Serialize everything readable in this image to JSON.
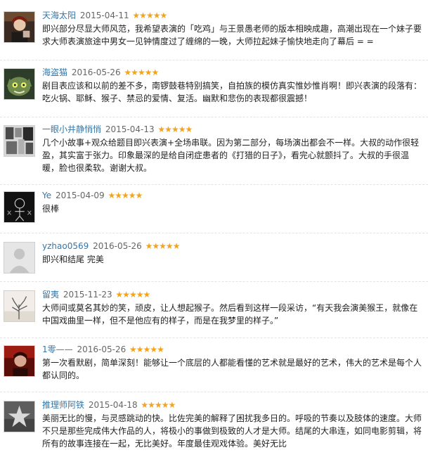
{
  "reviews": [
    {
      "user": "天海太阳",
      "date": "2015-04-11",
      "stars": "★★★★★",
      "text": "即兴部分尽显大师风范，我希望表演的「吃鸡」与王景愚老师的版本相映成趣，高潮出现在一个妹子要求大师表演旅途中男女一见钟情度过了缠绵的一晚，大师拉起妹子愉快地走向了幕后 = =",
      "avatar_icon": "portrait-avatar-icon"
    },
    {
      "user": "海盗猫",
      "date": "2016-05-26",
      "stars": "★★★★★",
      "text": "剧目表应该和以前的差不多，南锣鼓巷特别搞笑，自拍族的模仿真实惟妙惟肖啊！即兴表演的段落有：吃火锅、耶稣、猴子、禁忌的爱情、复活。幽默和悲伤的表现都很震撼！",
      "avatar_icon": "cat-avatar-icon"
    },
    {
      "user": "一眼小井静悄悄",
      "date": "2015-04-13",
      "stars": "★★★★★",
      "text": "几个小故事+观众给题目即兴表演+全场串联。因为第二部分，每场演出都会不一样。大叔的动作很轻盈，其实富于张力。印象最深的是给自闭症患者的《打猎的日子》，看完心就颤抖了。大叔的手很温暖，脸也很柔软。谢谢大叔。",
      "avatar_icon": "collage-avatar-icon"
    },
    {
      "user": "Ye",
      "date": "2015-04-09",
      "stars": "★★★★★",
      "text": "很棒",
      "avatar_icon": "sketch-avatar-icon"
    },
    {
      "user": "yzhao0569",
      "date": "2016-05-26",
      "stars": "★★★★★",
      "text": "即兴和结尾 完美",
      "avatar_icon": "default-avatar-icon"
    },
    {
      "user": "留夷",
      "date": "2015-11-23",
      "stars": "★★★★★",
      "text": "大师间或莫名其妙的笑，顽皮，让人想起猴子。然后看到这样一段采访，“有天我会演美猴王，就像在中国戏曲里一样，但不是他应有的样子，而是在我梦里的样子。”",
      "avatar_icon": "tree-avatar-icon"
    },
    {
      "user": "1零——",
      "date": "2016-05-26",
      "stars": "★★★★★",
      "text": "第一次看默剧，简单深刻！能够让一个底层的人都能看懂的艺术就是最好的艺术，伟大的艺术是每个人都认同的。",
      "avatar_icon": "red-avatar-icon"
    },
    {
      "user": "推理师阿铁",
      "date": "2015-04-18",
      "stars": "★★★★★",
      "text": "美丽无比的慢，与灵感跳动的快。比佐完美的解释了困扰我多日的。呼吸的节奏以及肢体的速度。大师不只是那些完成伟大作品的人，将极小的事做到极致的人才是大师。结尾的大串连，如同电影剪辑，将所有的故事连接在一起，无比美好。年度最佳观戏体验。美好无比",
      "avatar_icon": "star-avatar-icon"
    }
  ]
}
